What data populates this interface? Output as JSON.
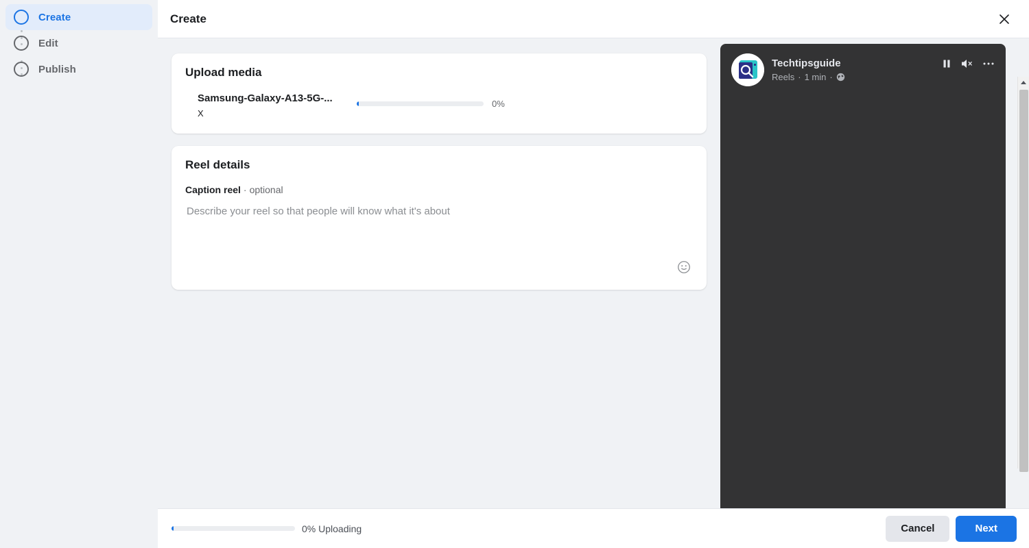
{
  "window": {
    "title": "Create",
    "close_icon": "close-icon"
  },
  "sidebar": {
    "steps": [
      {
        "label": "Create",
        "state": "active"
      },
      {
        "label": "Edit",
        "state": "inactive"
      },
      {
        "label": "Publish",
        "state": "inactive"
      }
    ]
  },
  "upload_media": {
    "title": "Upload media",
    "file_name": "Samsung-Galaxy-A13-5G-...",
    "remove_label": "X",
    "progress_percent": "0%",
    "progress_value": 0
  },
  "reel_details": {
    "title": "Reel details",
    "caption_label": "Caption reel",
    "caption_separator": "·",
    "caption_optional": "optional",
    "caption_value": "",
    "caption_placeholder": "Describe your reel so that people will know what it's about",
    "emoji_icon": "emoji-smiley-icon"
  },
  "preview": {
    "account_name": "Techtipsguide",
    "surface": "Reels",
    "separator_1": "·",
    "duration": "1 min",
    "separator_2": "·",
    "privacy_icon": "globe-icon",
    "avatar_icon": "magnifier-logo-avatar",
    "controls": [
      {
        "name": "pause-icon",
        "label": "Pause"
      },
      {
        "name": "mute-icon",
        "label": "Mute"
      },
      {
        "name": "more-options-icon",
        "label": "More options"
      }
    ]
  },
  "footer": {
    "progress_percent": 0,
    "status_text": "0% Uploading",
    "cancel_label": "Cancel",
    "next_label": "Next"
  },
  "colors": {
    "accent_blue": "#1b74e4",
    "sidebar_bg": "#f0f2f5",
    "active_step_bg": "#e2ecfb",
    "preview_bg": "#333334",
    "muted_text": "#65676b"
  }
}
